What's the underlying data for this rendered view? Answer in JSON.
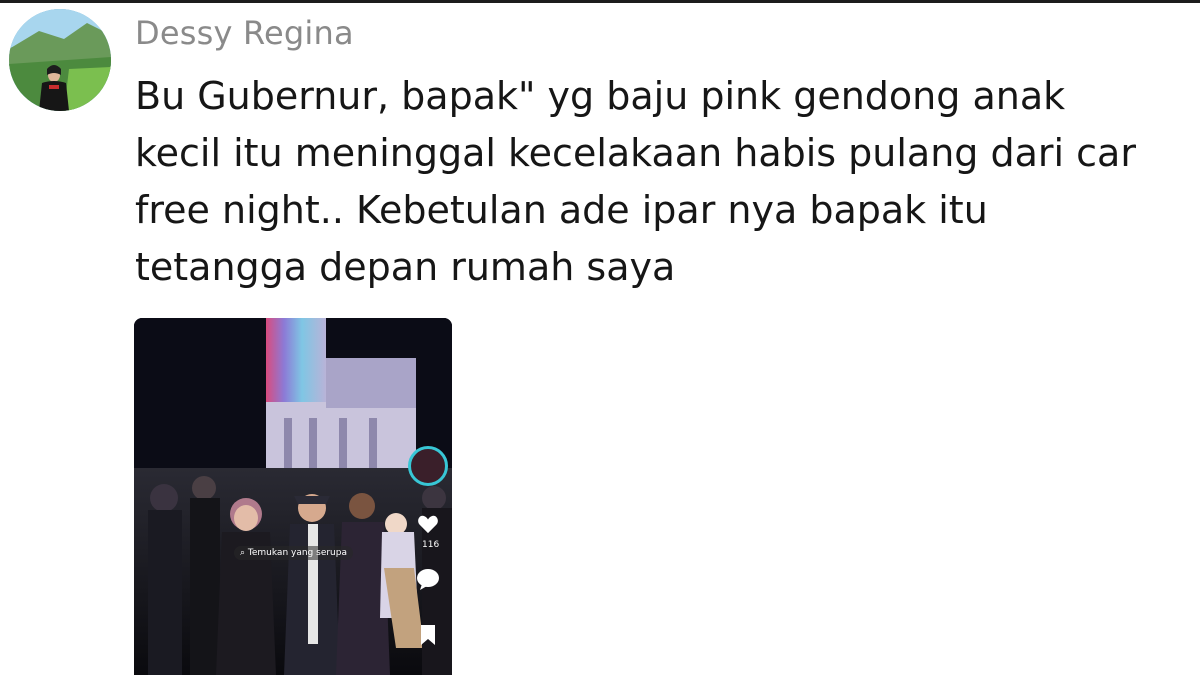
{
  "comment": {
    "username": "Dessy Regina",
    "text_lines": [
      "Bu Gubernur, bapak\" yg baju pink gendong anak",
      "kecil itu meninggal kecelakaan habis pulang dari car",
      "free night.. Kebetulan ade ipar nya bapak itu",
      "tetangga depan rumah saya"
    ]
  },
  "attachment": {
    "overlay_label": "Temukan yang serupa",
    "like_count": "116",
    "icons": [
      "heart-icon",
      "comment-icon",
      "bookmark-icon",
      "profile-avatar-icon"
    ]
  },
  "colors": {
    "username": "#8a8a8a",
    "text": "#161616",
    "background": "#ffffff",
    "ring_accent": "#38c7d6"
  }
}
